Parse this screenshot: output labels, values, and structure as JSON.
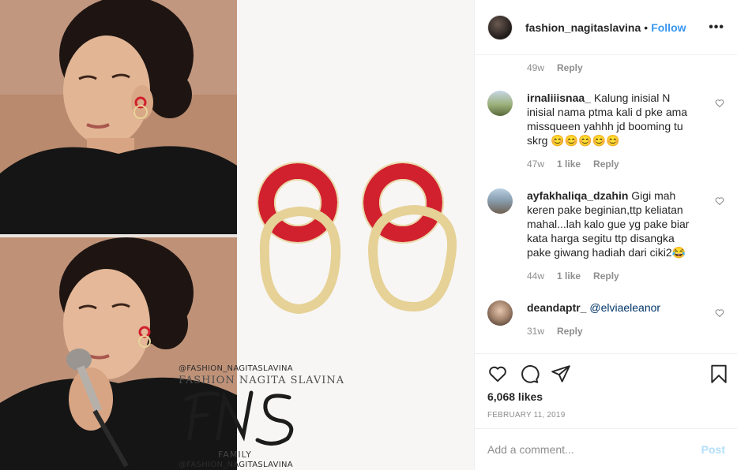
{
  "post": {
    "watermark": {
      "handle_top": "@FASHION_NAGITASLAVINA",
      "name": "FASHION NAGITA SLAVINA",
      "family": "FAMILY",
      "handle_bottom": "@FASHION_NAGITASLAVINA"
    }
  },
  "header": {
    "username": "fashion_nagitaslavina",
    "separator": "•",
    "follow_label": "Follow",
    "more_label": "•••"
  },
  "comments": {
    "top_meta": {
      "time": "49w",
      "reply": "Reply"
    },
    "items": [
      {
        "username": "irnaliiisnaa_",
        "text": "Kalung inisial N inisial nama ptma kali d pke ama missqueen yahhh jd booming tu skrg 😊😊😊😊😊",
        "time": "47w",
        "likes": "1 like",
        "reply": "Reply"
      },
      {
        "username": "ayfakhaliqa_dzahin",
        "text": "Gigi mah keren pake beginian,ttp keliatan mahal...lah kalo gue yg pake biar kata harga segitu ttp disangka pake giwang hadiah dari ciki2😂",
        "time": "44w",
        "likes": "1 like",
        "reply": "Reply"
      },
      {
        "username": "deandaptr_",
        "mention": "@elviaeleanor",
        "time": "31w",
        "reply": "Reply"
      }
    ]
  },
  "actions": {
    "likes": "6,068 likes",
    "date": "FEBRUARY 11, 2019"
  },
  "add_comment": {
    "placeholder": "Add a comment...",
    "post_label": "Post"
  },
  "colors": {
    "accent": "#3897f0",
    "muted": "#8e8e8e",
    "post_disabled": "#b2dffc",
    "earring_red": "#d1202e",
    "earring_gold": "#e8d49a"
  }
}
